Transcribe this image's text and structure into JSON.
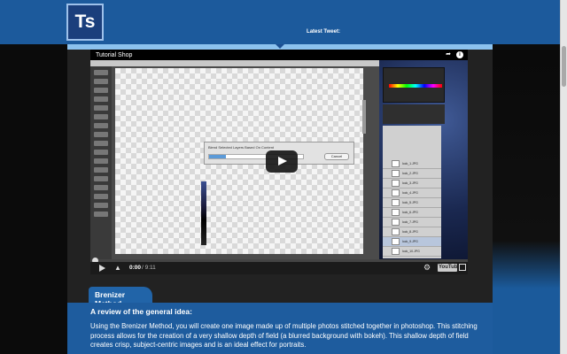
{
  "header": {
    "logo_text": "Ts",
    "tweet_label": "Latest Tweet:"
  },
  "video": {
    "title": "Tutorial Shop",
    "dialog_message": "Blend Selected Layers Based On Content",
    "dialog_progress": 0.18,
    "dialog_cancel_label": "Cancel",
    "current_time": "0:00",
    "total_time": "/ 9:11",
    "youtube_label": "YouTube",
    "layer_names": [
      "lock_1.JPG",
      "lock_2.JPG",
      "lock_3.JPG",
      "lock_4.JPG",
      "lock_5.JPG",
      "lock_6.JPG",
      "lock_7.JPG",
      "lock_8.JPG",
      "lock_9.JPG",
      "lock_10.JPG"
    ]
  },
  "section": {
    "tab_label": "Brenizer Method",
    "heading": "A review of the general idea:",
    "body": "Using the Brenizer Method, you will create one image made up of multiple photos stitched together in photoshop. This stitching process allows for the creation of a very shallow depth of field (a blurred background with bokeh). This shallow depth of field creates crisp, subject-centric images and is an ideal effect for portraits."
  },
  "colors": {
    "header_blue": "#1c5a9c",
    "band_light_blue": "#8cc2ee",
    "article_blue": "#1e5c9e"
  },
  "icons": {
    "share": "share-icon",
    "info": "info-icon",
    "play": "play-icon",
    "volume": "volume-icon",
    "settings": "gear-icon",
    "fullscreen": "fullscreen-icon"
  }
}
